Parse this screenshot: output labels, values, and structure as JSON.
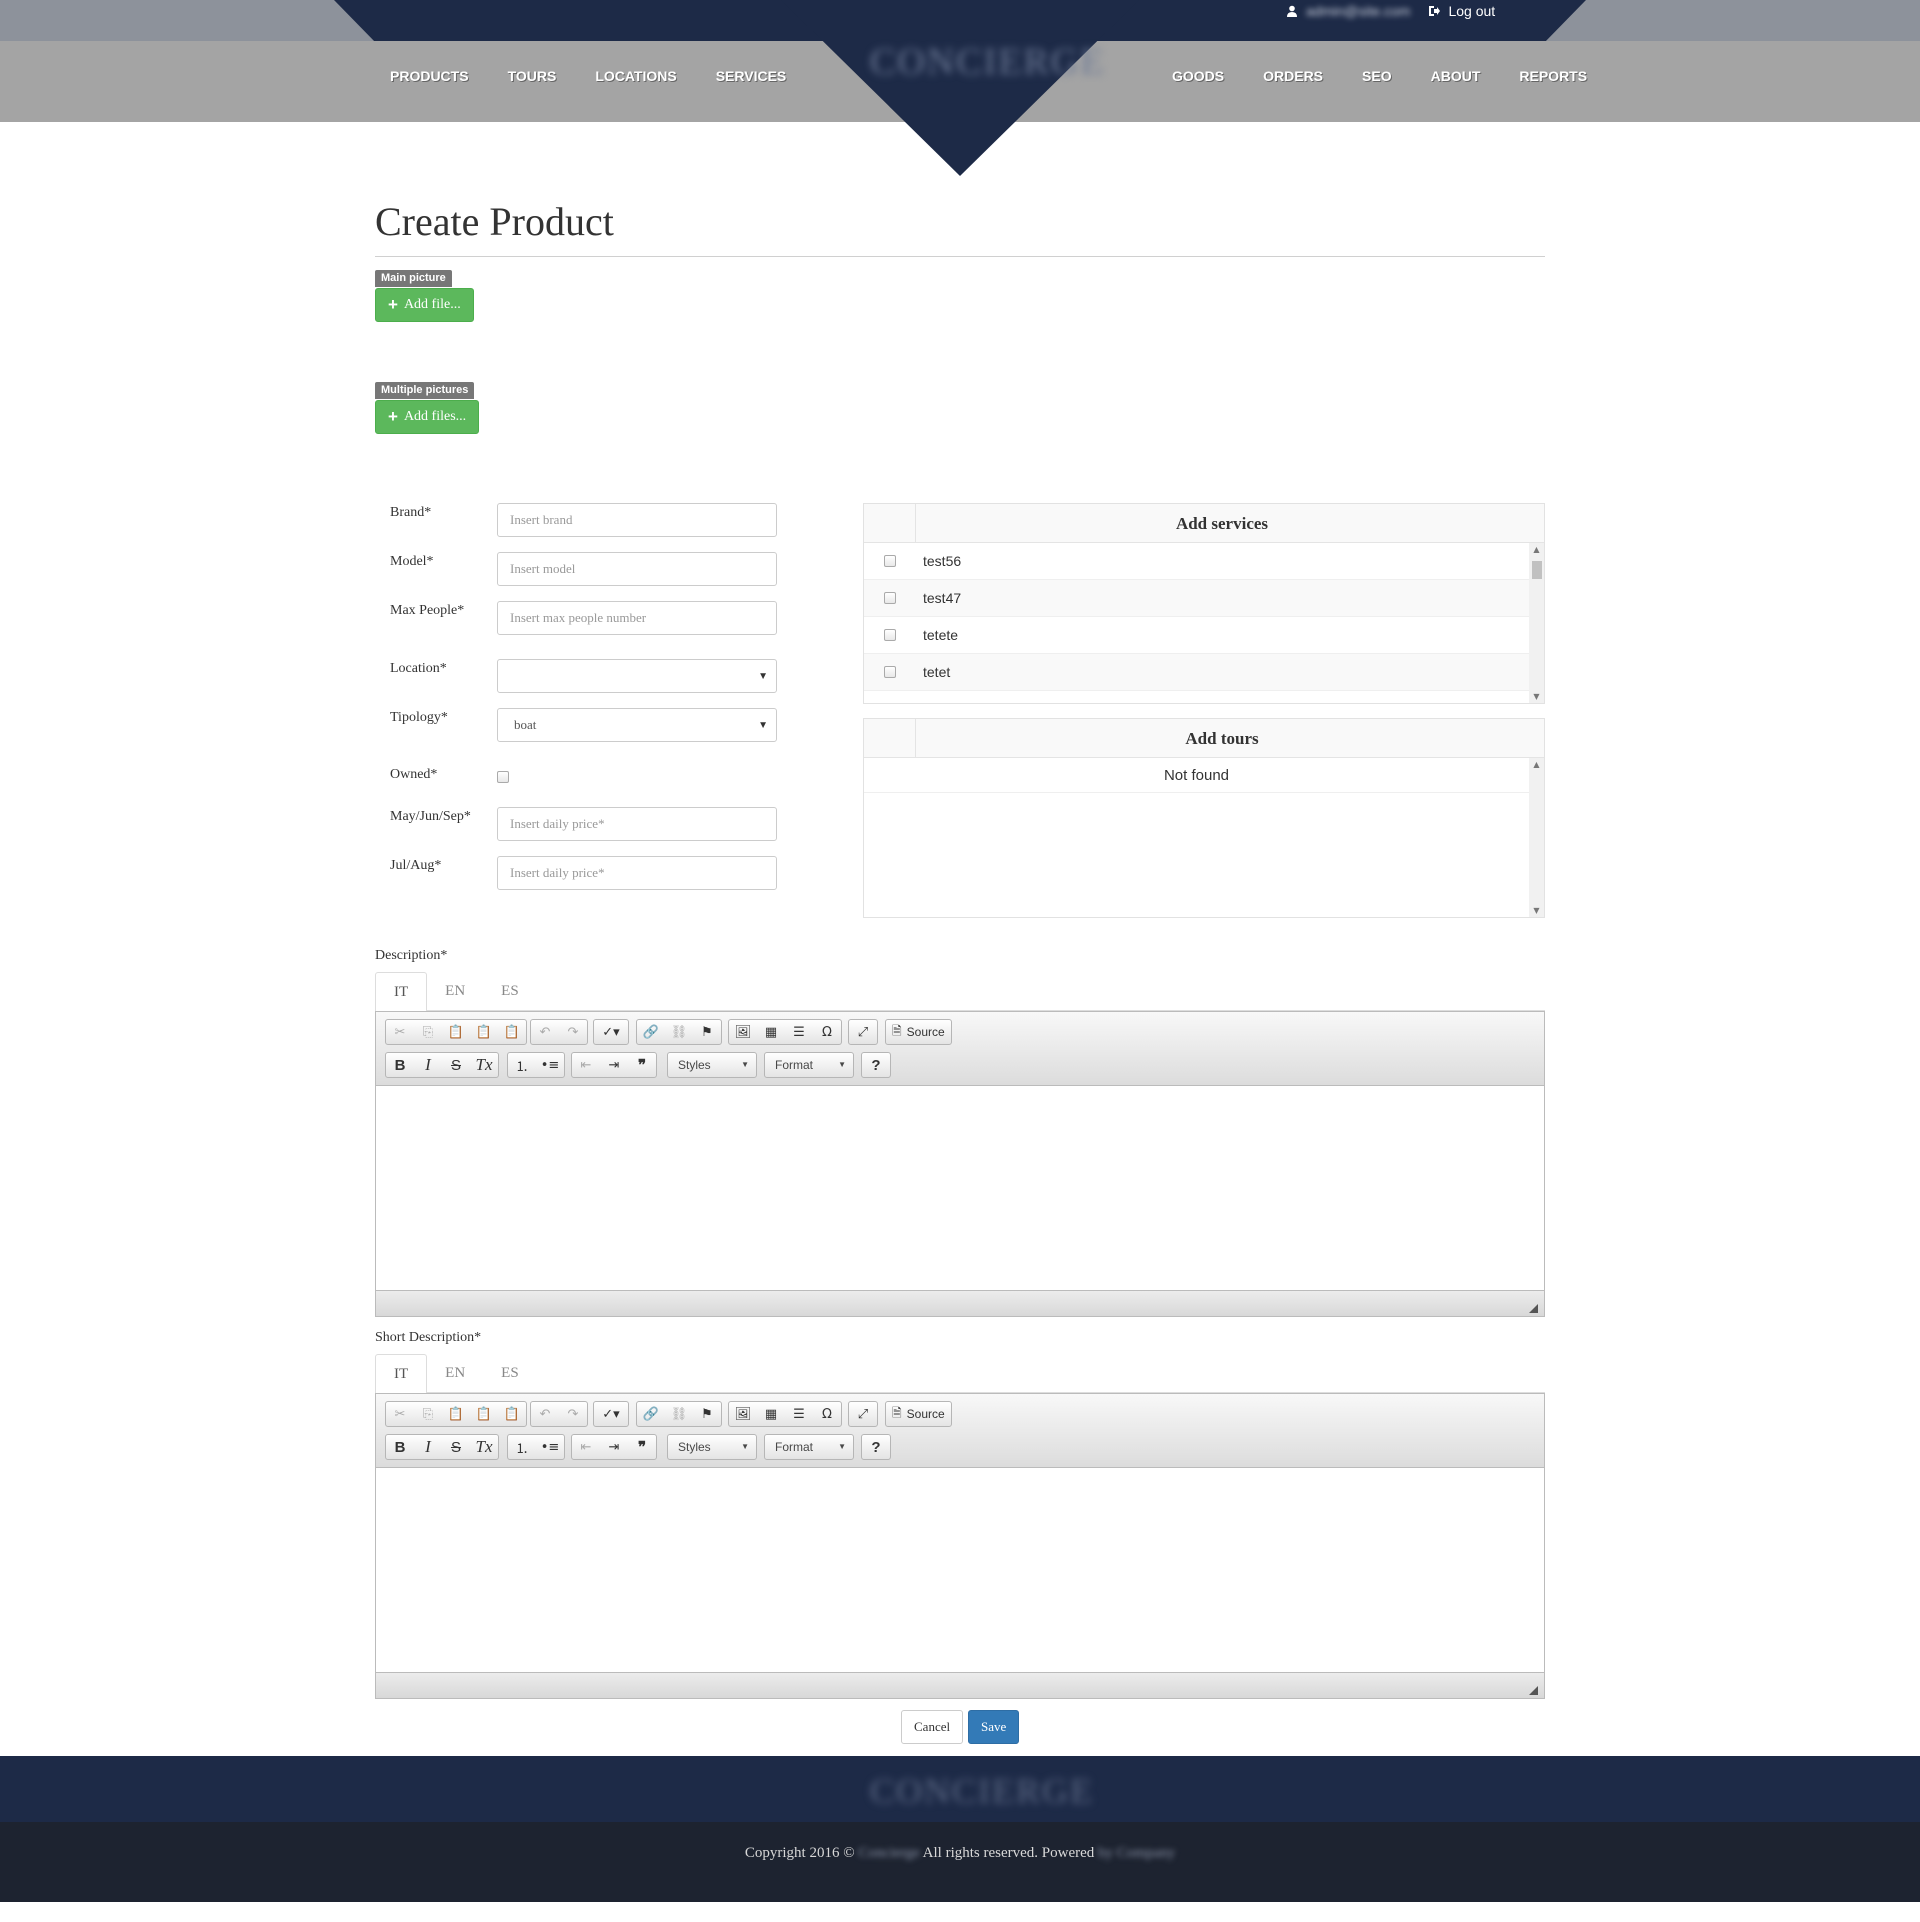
{
  "header": {
    "user_email": "admin@site.com",
    "logout_label": "Log out",
    "logo_text": "CONCIERGE",
    "nav_left": [
      "PRODUCTS",
      "TOURS",
      "LOCATIONS",
      "SERVICES"
    ],
    "nav_right": [
      "GOODS",
      "ORDERS",
      "SEO",
      "ABOUT",
      "REPORTS"
    ]
  },
  "page": {
    "title": "Create Product"
  },
  "uploads": {
    "main_label": "Main picture",
    "main_button": "Add file...",
    "multi_label": "Multiple pictures",
    "multi_button": "Add files..."
  },
  "form": {
    "brand": {
      "label": "Brand*",
      "placeholder": "Insert brand"
    },
    "model": {
      "label": "Model*",
      "placeholder": "Insert model"
    },
    "max_people": {
      "label": "Max People*",
      "placeholder": "Insert max people number"
    },
    "location": {
      "label": "Location*",
      "value": ""
    },
    "tipology": {
      "label": "Tipology*",
      "value": "boat"
    },
    "owned": {
      "label": "Owned*"
    },
    "price_may": {
      "label": "May/Jun/Sep*",
      "placeholder": "Insert daily price*"
    },
    "price_jul": {
      "label": "Jul/Aug*",
      "placeholder": "Insert daily price*"
    }
  },
  "services": {
    "title": "Add services",
    "items": [
      "test56",
      "test47",
      "tetete",
      "tetet"
    ]
  },
  "tours": {
    "title": "Add tours",
    "empty_text": "Not found"
  },
  "description": {
    "label": "Description*",
    "tabs": [
      "IT",
      "EN",
      "ES"
    ]
  },
  "short_description": {
    "label": "Short Description*",
    "tabs": [
      "IT",
      "EN",
      "ES"
    ]
  },
  "editor": {
    "source_label": "Source",
    "styles_label": "Styles",
    "format_label": "Format",
    "help_label": "?"
  },
  "actions": {
    "cancel": "Cancel",
    "save": "Save"
  },
  "footer": {
    "logo_text": "CONCIERGE",
    "copyright": "Copyright 2016 ©",
    "company": "Concierge",
    "rights": "All rights reserved. Powered",
    "powered_by": "by Company"
  }
}
